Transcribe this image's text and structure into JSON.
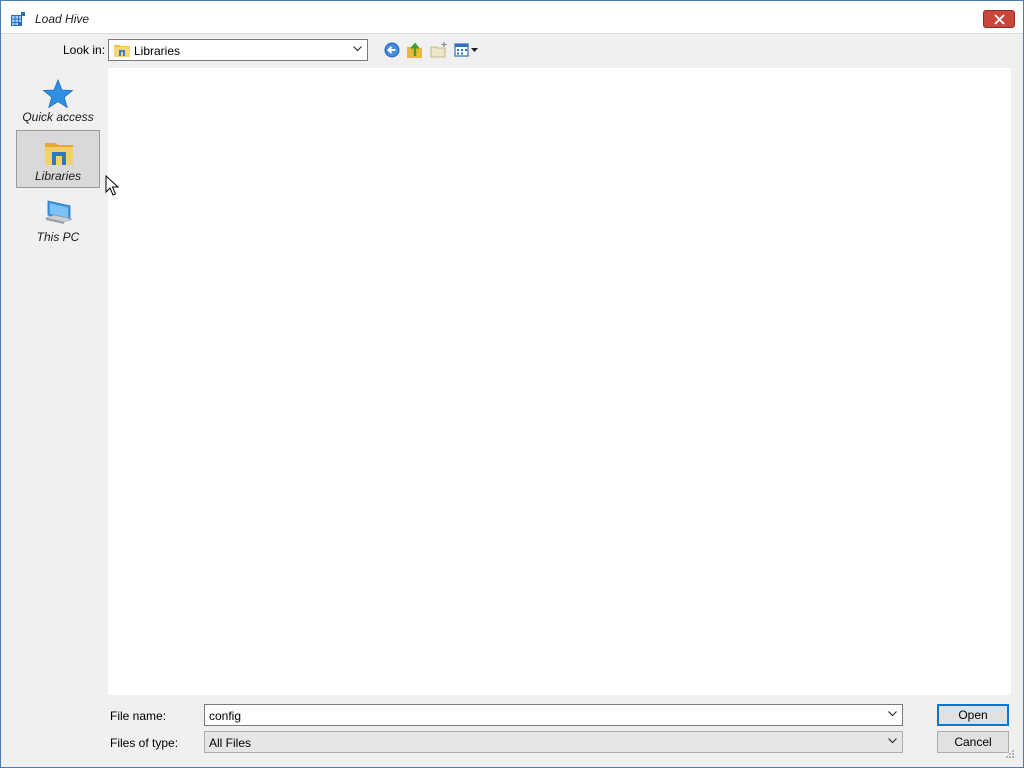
{
  "window": {
    "title": "Load Hive"
  },
  "toolbar": {
    "look_in_label": "Look in:",
    "look_in_value": "Libraries"
  },
  "places": [
    {
      "label": "Quick access",
      "icon": "star-icon"
    },
    {
      "label": "Libraries",
      "icon": "libraries-folder-icon",
      "selected": true
    },
    {
      "label": "This PC",
      "icon": "computer-icon"
    }
  ],
  "footer": {
    "file_name_label": "File name:",
    "file_name_value": "config",
    "file_type_label": "Files of type:",
    "file_type_value": "All Files",
    "open_label": "Open",
    "cancel_label": "Cancel"
  },
  "colors": {
    "accent": "#0078d7",
    "close": "#c9463d",
    "selected_place": "#d9d9d9"
  }
}
